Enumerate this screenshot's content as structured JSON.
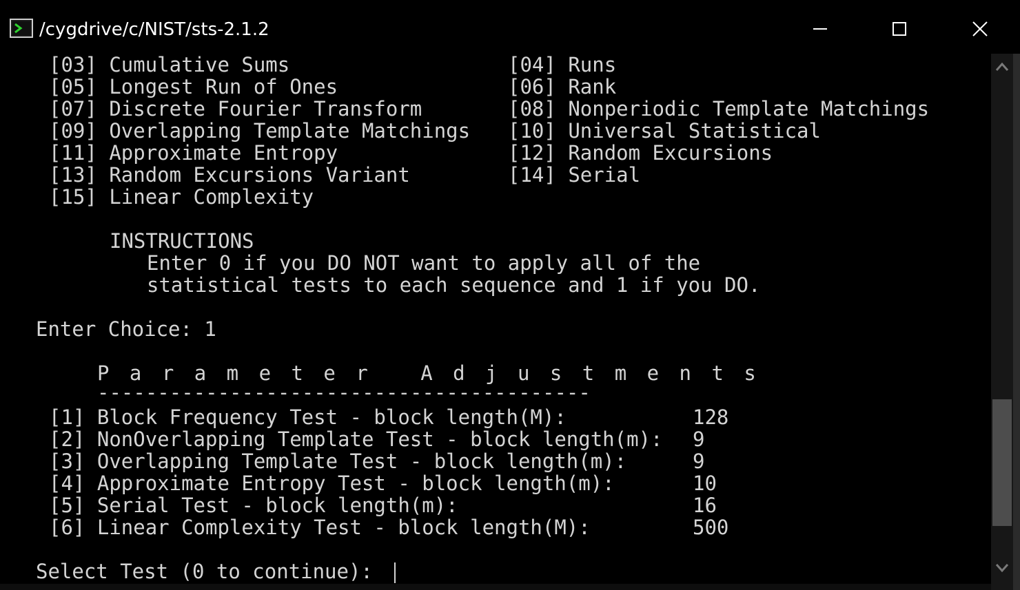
{
  "window": {
    "title": "/cygdrive/c/NIST/sts-2.1.2",
    "colors": {
      "background": "#000000",
      "text": "#d4d4d4",
      "title_text": "#ffffff",
      "scroll_thumb": "#4d4d4d"
    },
    "icons": {
      "app": "cygwin-terminal-icon",
      "minimize": "minimize-icon",
      "maximize": "maximize-icon",
      "close": "close-icon",
      "scroll_up": "chevron-up-icon",
      "scroll_down": "chevron-down-icon"
    }
  },
  "terminal": {
    "tests": [
      {
        "num": "[03]",
        "name": "Cumulative Sums"
      },
      {
        "num": "[04]",
        "name": "Runs"
      },
      {
        "num": "[05]",
        "name": "Longest Run of Ones"
      },
      {
        "num": "[06]",
        "name": "Rank"
      },
      {
        "num": "[07]",
        "name": "Discrete Fourier Transform"
      },
      {
        "num": "[08]",
        "name": "Nonperiodic Template Matchings"
      },
      {
        "num": "[09]",
        "name": "Overlapping Template Matchings"
      },
      {
        "num": "[10]",
        "name": "Universal Statistical"
      },
      {
        "num": "[11]",
        "name": "Approximate Entropy"
      },
      {
        "num": "[12]",
        "name": "Random Excursions"
      },
      {
        "num": "[13]",
        "name": "Random Excursions Variant"
      },
      {
        "num": "[14]",
        "name": "Serial"
      },
      {
        "num": "[15]",
        "name": "Linear Complexity"
      }
    ],
    "instructions": {
      "heading": "INSTRUCTIONS",
      "line1": "Enter 0 if you DO NOT want to apply all of the",
      "line2": "statistical tests to each sequence and 1 if you DO."
    },
    "choice_prompt": "Enter Choice: 1",
    "params_heading": "P a r a m e t e r   A d j u s t m e n t s",
    "params_rule": "-----------------------------------------",
    "params": [
      {
        "num": "[1]",
        "label": "Block Frequency Test - block length(M):",
        "value": "128"
      },
      {
        "num": "[2]",
        "label": "NonOverlapping Template Test - block length(m):",
        "value": "9"
      },
      {
        "num": "[3]",
        "label": "Overlapping Template Test - block length(m):",
        "value": "9"
      },
      {
        "num": "[4]",
        "label": "Approximate Entropy Test - block length(m):",
        "value": "10"
      },
      {
        "num": "[5]",
        "label": "Serial Test - block length(m):",
        "value": "16"
      },
      {
        "num": "[6]",
        "label": "Linear Complexity Test - block length(M):",
        "value": "500"
      }
    ],
    "select_prompt": "Select Test (0 to continue):"
  }
}
